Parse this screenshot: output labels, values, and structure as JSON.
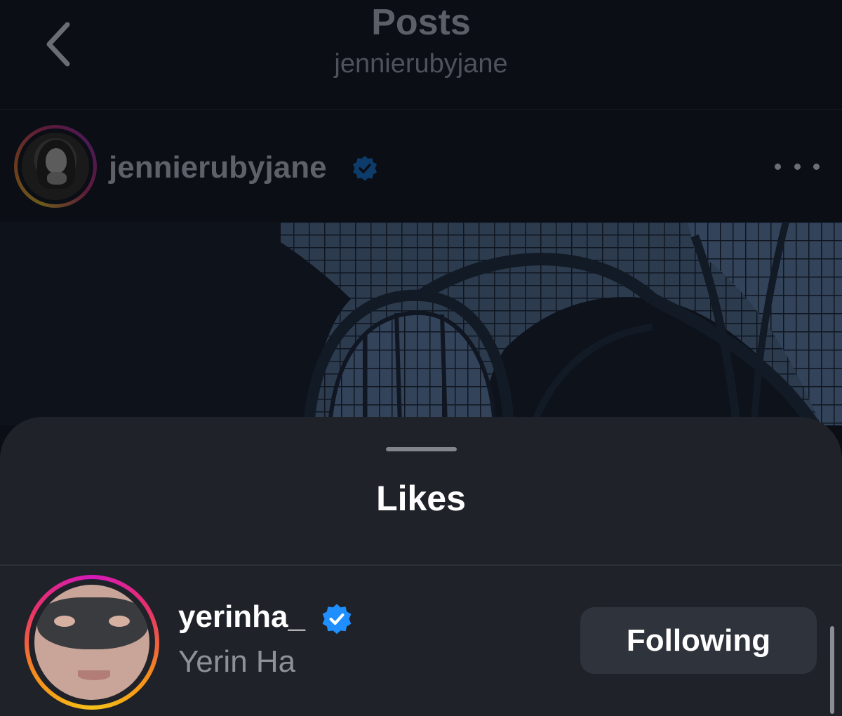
{
  "header": {
    "title": "Posts",
    "subtitle": "jennierubyjane",
    "back_icon": "chevron-left-icon"
  },
  "post": {
    "username": "jennierubyjane",
    "verified": true,
    "more_icon": "more-horizontal-icon"
  },
  "likes_sheet": {
    "title": "Likes",
    "items": [
      {
        "username": "yerinha_",
        "full_name": "Yerin Ha",
        "verified": true,
        "button_label": "Following"
      }
    ]
  },
  "colors": {
    "verified_blue": "#1f8fff",
    "sheet_background": "#1f2229",
    "button_background": "#2f333b"
  }
}
